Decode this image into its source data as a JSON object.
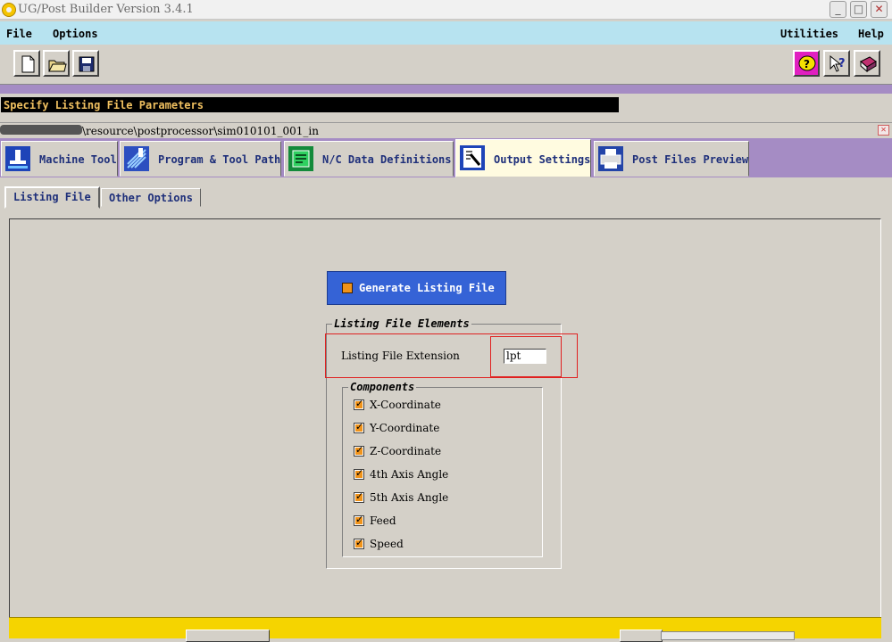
{
  "window": {
    "title": "UG/Post Builder Version 3.4.1",
    "controls": [
      "_",
      "□",
      "✕"
    ]
  },
  "menu": {
    "file": "File",
    "options": "Options",
    "utilities": "Utilities",
    "help": "Help"
  },
  "toolbar": {
    "left": [
      "new-file-icon",
      "open-folder-icon",
      "save-icon"
    ],
    "right": [
      "balloon-help-icon",
      "context-help-icon",
      "manual-book-icon"
    ]
  },
  "status": {
    "message": "Specify Listing File Parameters"
  },
  "path": {
    "text": "\\resource\\postprocessor\\sim010101_001_in"
  },
  "main_tabs": [
    {
      "label": "Machine Tool",
      "active": false
    },
    {
      "label": "Program & Tool Path",
      "active": false
    },
    {
      "label": "N/C Data Definitions",
      "active": false
    },
    {
      "label": "Output Settings",
      "active": true
    },
    {
      "label": "Post Files Preview",
      "active": false
    }
  ],
  "sub_tabs": [
    {
      "label": "Listing File",
      "active": true
    },
    {
      "label": "Other Options",
      "active": false
    }
  ],
  "listing": {
    "generate_label": "Generate Listing File",
    "generate_checked": true,
    "elements_title": "Listing File Elements",
    "extension_label": "Listing File Extension",
    "extension_value": "lpt",
    "components_title": "Components",
    "components": [
      {
        "label": "X-Coordinate",
        "checked": true
      },
      {
        "label": "Y-Coordinate",
        "checked": true
      },
      {
        "label": "Z-Coordinate",
        "checked": true
      },
      {
        "label": "4th Axis Angle",
        "checked": true
      },
      {
        "label": "5th Axis Angle",
        "checked": true
      },
      {
        "label": "Feed",
        "checked": true
      },
      {
        "label": "Speed",
        "checked": true
      }
    ]
  },
  "colors": {
    "menu_bg": "#b7e3f0",
    "tab_row_bg": "#a58cc4",
    "active_tab_bg": "#fffbe0",
    "generate_button_bg": "#3563d6",
    "checkbox_fill": "#f0931a",
    "bottom_strip": "#f5d400",
    "highlight_red": "#e02020"
  }
}
